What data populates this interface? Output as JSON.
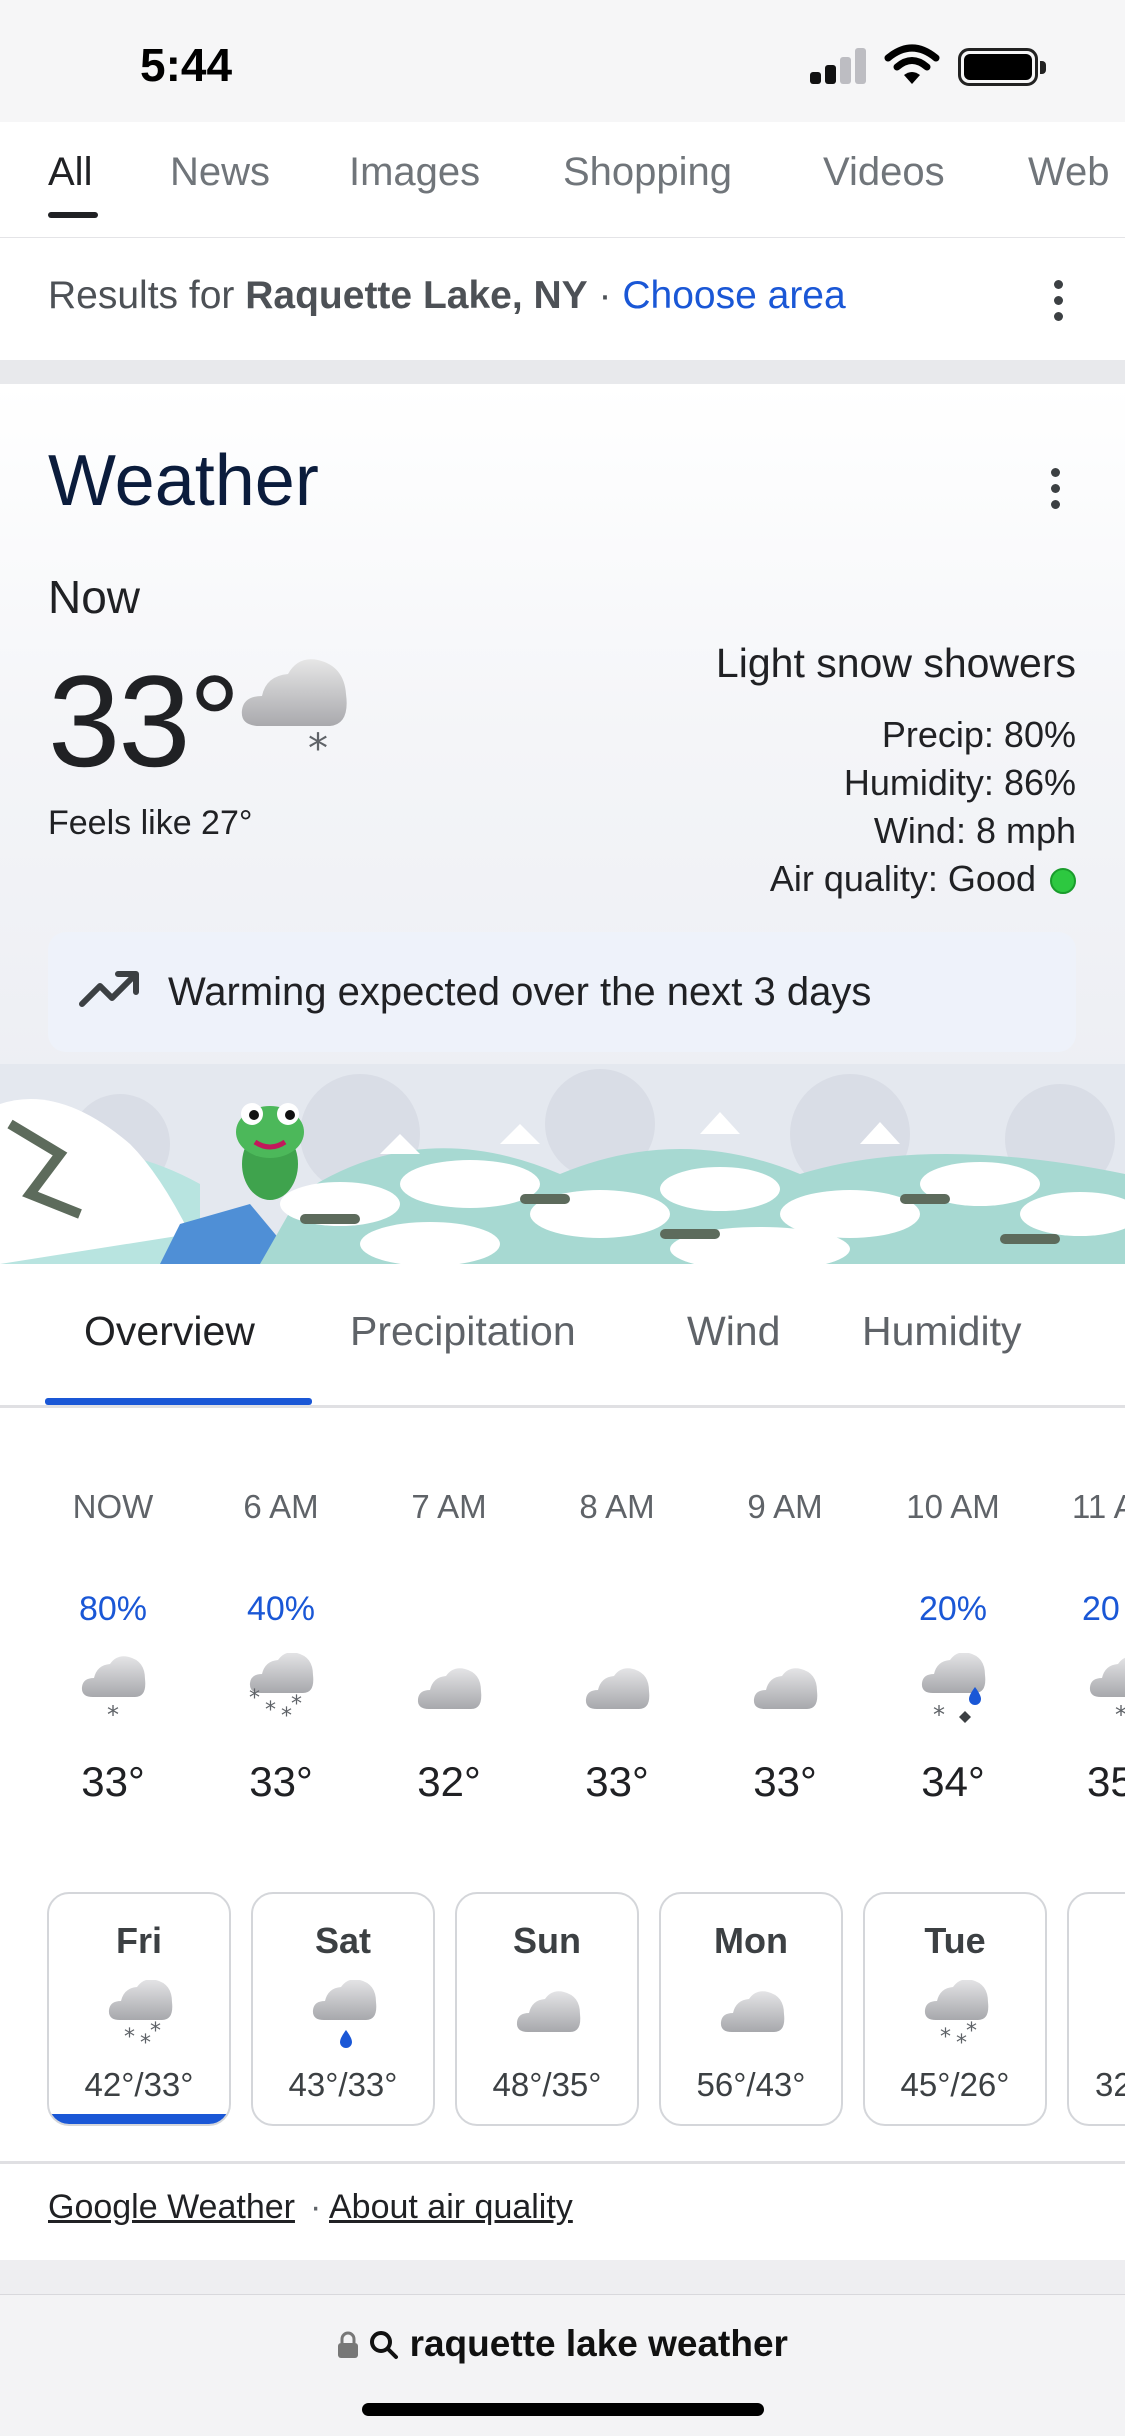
{
  "status_bar": {
    "time": "5:44"
  },
  "search_tabs": [
    "All",
    "News",
    "Images",
    "Shopping",
    "Videos",
    "Web"
  ],
  "results_for": {
    "prefix": "Results for",
    "location": "Raquette Lake, NY",
    "separator": "·",
    "action": "Choose area"
  },
  "weather": {
    "title": "Weather",
    "now_label": "Now",
    "temperature": "33°",
    "feels_like": "Feels like 27°",
    "condition": "Light snow showers",
    "precip": "Precip: 80%",
    "humidity": "Humidity: 86%",
    "wind": "Wind: 8 mph",
    "air_quality": "Air quality: Good",
    "air_quality_color": "#2dc840",
    "trend": "Warming expected over the next 3 days"
  },
  "overview_tabs": [
    "Overview",
    "Precipitation",
    "Wind",
    "Humidity"
  ],
  "hourly": [
    {
      "time": "NOW",
      "precip": "80%",
      "icon": "cloud-snow",
      "temp": "33°"
    },
    {
      "time": "6 AM",
      "precip": "40%",
      "icon": "cloud-heavy-snow",
      "temp": "33°"
    },
    {
      "time": "7 AM",
      "precip": "",
      "icon": "cloud",
      "temp": "32°"
    },
    {
      "time": "8 AM",
      "precip": "",
      "icon": "cloud",
      "temp": "33°"
    },
    {
      "time": "9 AM",
      "precip": "",
      "icon": "cloud",
      "temp": "33°"
    },
    {
      "time": "10 AM",
      "precip": "20%",
      "icon": "cloud-mixed",
      "temp": "34°"
    },
    {
      "time": "11 A",
      "precip": "20",
      "icon": "cloud-snow",
      "temp": "35"
    }
  ],
  "daily": [
    {
      "day": "Fri",
      "icon": "cloud-heavy-snow",
      "range": "42°/33°",
      "selected": true
    },
    {
      "day": "Sat",
      "icon": "cloud-rain",
      "range": "43°/33°"
    },
    {
      "day": "Sun",
      "icon": "cloud",
      "range": "48°/35°"
    },
    {
      "day": "Mon",
      "icon": "cloud",
      "range": "56°/43°"
    },
    {
      "day": "Tue",
      "icon": "cloud-heavy-snow",
      "range": "45°/26°"
    },
    {
      "day": "W",
      "icon": "cloud",
      "range": "32"
    }
  ],
  "footer_links": {
    "google_weather": "Google Weather",
    "separator": "·",
    "about_air_quality": "About air quality"
  },
  "url_bar": {
    "query": "raquette lake weather"
  },
  "colors": {
    "accent_blue": "#1a57d6",
    "title_navy": "#0b1c3c"
  }
}
